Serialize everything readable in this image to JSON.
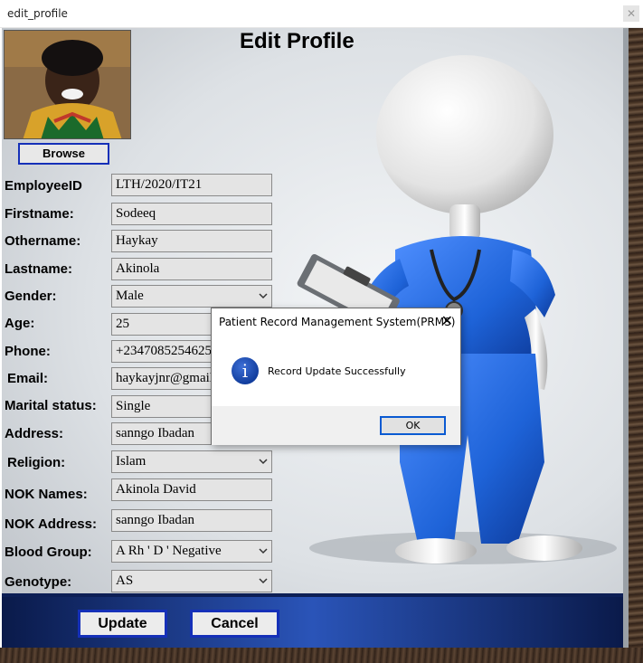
{
  "window": {
    "title": "edit_profile",
    "close_icon": "close-icon"
  },
  "page_title": "Edit Profile",
  "browse_label": "Browse",
  "fields": [
    {
      "label": "EmployeeID",
      "value": "LTH/2020/IT21",
      "type": "text"
    },
    {
      "label": "Firstname:",
      "value": "Sodeeq",
      "type": "text"
    },
    {
      "label": "Othername:",
      "value": "Haykay",
      "type": "text"
    },
    {
      "label": "Lastname:",
      "value": "Akinola",
      "type": "text"
    },
    {
      "label": "Gender:",
      "value": "Male",
      "type": "select"
    },
    {
      "label": "Age:",
      "value": "25",
      "type": "text"
    },
    {
      "label": "Phone:",
      "value": "+2347085254625",
      "type": "text"
    },
    {
      "label": "Email:",
      "value": "haykayjnr@gmail.com",
      "type": "text"
    },
    {
      "label": "Marital status:",
      "value": "Single",
      "type": "select"
    },
    {
      "label": "Address:",
      "value": "sanngo Ibadan",
      "type": "text"
    },
    {
      "label": "Religion:",
      "value": "Islam",
      "type": "select"
    },
    {
      "label": "NOK Names:",
      "value": "Akinola David",
      "type": "text"
    },
    {
      "label": "NOK Address:",
      "value": "sanngo Ibadan",
      "type": "text"
    },
    {
      "label": "Blood Group:",
      "value": "A Rh ' D ' Negative",
      "type": "select"
    },
    {
      "label": "Genotype:",
      "value": "AS",
      "type": "select"
    }
  ],
  "buttons": {
    "update": "Update",
    "cancel": "Cancel"
  },
  "dialog": {
    "title": "Patient Record Management System(PRMS)",
    "close_glyph": "✕",
    "icon": "info-icon",
    "icon_glyph": "i",
    "message": "Record Update Successfully",
    "ok_label": "OK"
  },
  "colors": {
    "accent_border": "#1530b8",
    "bar_blue": "#2a54b8",
    "figure_blue": "#1e63d8"
  }
}
